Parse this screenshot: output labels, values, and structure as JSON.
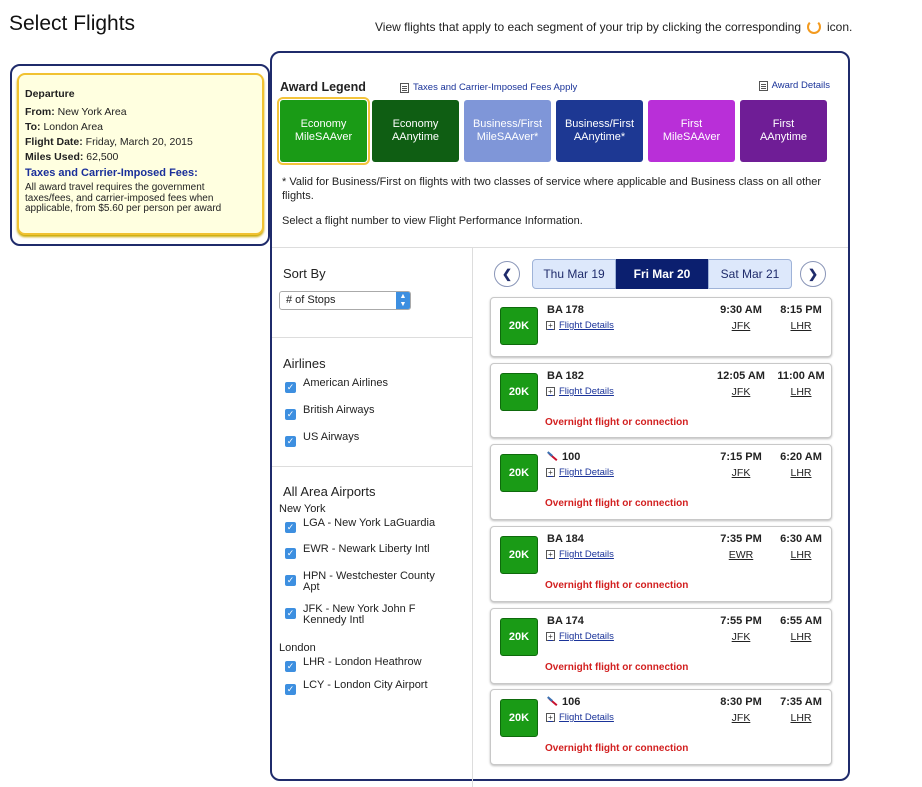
{
  "page": {
    "title": "Select Flights",
    "header_note_before": "View flights that apply to each segment of your trip by clicking the corresponding",
    "header_note_after": "icon."
  },
  "departure": {
    "title": "Departure",
    "from_label": "From:",
    "from_value": "New York Area",
    "to_label": "To:",
    "to_value": "London Area",
    "date_label": "Flight Date:",
    "date_value": "Friday, March 20, 2015",
    "miles_label": "Miles Used:",
    "miles_value": "62,500",
    "fees_title": "Taxes and Carrier-Imposed Fees:",
    "fees_text": "All award travel requires the government taxes/fees, and carrier-imposed fees when applicable, from $5.60 per person per award"
  },
  "legend": {
    "title": "Award Legend",
    "taxes_link": "Taxes and Carrier-Imposed Fees Apply",
    "award_details_link": "Award Details",
    "items": [
      {
        "line1": "Economy",
        "line2": "MileSAAver",
        "color": "#1a9b16",
        "selected": true
      },
      {
        "line1": "Economy",
        "line2": "AAnytime",
        "color": "#0f5e13"
      },
      {
        "line1": "Business/First",
        "line2": "MileSAAver*",
        "color": "#7f96d8"
      },
      {
        "line1": "Business/First",
        "line2": "AAnytime*",
        "color": "#1d3893"
      },
      {
        "line1": "First",
        "line2": "MileSAAver",
        "color": "#b92fd8"
      },
      {
        "line1": "First",
        "line2": "AAnytime",
        "color": "#6f1d96"
      }
    ],
    "note_valid": "* Valid for Business/First on flights with two classes of service where applicable and Business class on all other flights.",
    "note_select": "Select a flight number to view Flight Performance Information."
  },
  "filters": {
    "sort_title": "Sort By",
    "sort_value": "# of Stops",
    "airlines_title": "Airlines",
    "airlines": [
      "American Airlines",
      "British Airways",
      "US Airways"
    ],
    "airports_title": "All Area Airports",
    "city1": "New York",
    "ny_airports": [
      "LGA - New York LaGuardia",
      "EWR - Newark Liberty Intl",
      "HPN - Westchester County Apt",
      "JFK - New York John F Kennedy Intl"
    ],
    "city2": "London",
    "london_airports": [
      "LHR - London Heathrow",
      "LCY - London City Airport"
    ]
  },
  "dates": {
    "prev": "Thu Mar 19",
    "current": "Fri Mar 20",
    "next": "Sat Mar 21"
  },
  "flights": [
    {
      "miles": "20K",
      "number": "BA 178",
      "details": "Flight Details",
      "depart": "9:30 AM",
      "arrive": "8:15 PM",
      "from": "JFK",
      "to": "LHR",
      "note": ""
    },
    {
      "miles": "20K",
      "number": "BA 182",
      "details": "Flight Details",
      "depart": "12:05 AM",
      "arrive": "11:00 AM",
      "from": "JFK",
      "to": "LHR",
      "note": "Overnight flight or connection"
    },
    {
      "miles": "20K",
      "number": "100",
      "details": "Flight Details",
      "depart": "7:15 PM",
      "arrive": "6:20 AM",
      "from": "JFK",
      "to": "LHR",
      "note": "Overnight flight or connection"
    },
    {
      "miles": "20K",
      "number": "BA 184",
      "details": "Flight Details",
      "depart": "7:35 PM",
      "arrive": "6:30 AM",
      "from": "EWR",
      "to": "LHR",
      "note": "Overnight flight or connection"
    },
    {
      "miles": "20K",
      "number": "BA 174",
      "details": "Flight Details",
      "depart": "7:55 PM",
      "arrive": "6:55 AM",
      "from": "JFK",
      "to": "LHR",
      "note": "Overnight flight or connection"
    },
    {
      "miles": "20K",
      "number": "106",
      "details": "Flight Details",
      "depart": "8:30 PM",
      "arrive": "7:35 AM",
      "from": "JFK",
      "to": "LHR",
      "note": "Overnight flight or connection"
    }
  ]
}
